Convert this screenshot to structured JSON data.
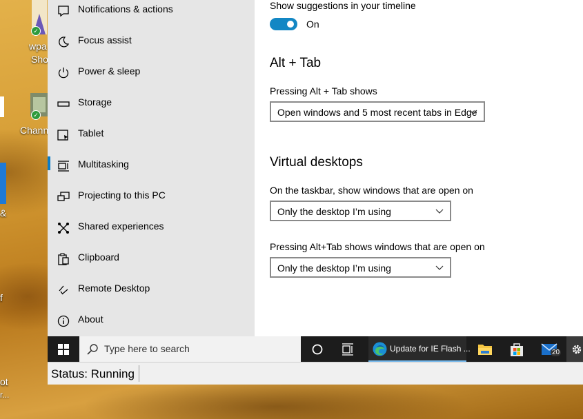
{
  "desktop": {
    "icons": [
      {
        "label": "wpa"
      },
      {
        "label": "Sho"
      },
      {
        "label": "Chann"
      },
      {
        "label": "&"
      },
      {
        "label": "f"
      },
      {
        "label": "ot"
      },
      {
        "label": "r..."
      }
    ]
  },
  "sidebar": {
    "items": [
      {
        "label": "Notifications & actions",
        "icon": "notification-icon"
      },
      {
        "label": "Focus assist",
        "icon": "moon-icon"
      },
      {
        "label": "Power & sleep",
        "icon": "power-icon"
      },
      {
        "label": "Storage",
        "icon": "storage-icon"
      },
      {
        "label": "Tablet",
        "icon": "tablet-icon"
      },
      {
        "label": "Multitasking",
        "icon": "multitasking-icon",
        "active": true
      },
      {
        "label": "Projecting to this PC",
        "icon": "projecting-icon"
      },
      {
        "label": "Shared experiences",
        "icon": "shared-icon"
      },
      {
        "label": "Clipboard",
        "icon": "clipboard-icon"
      },
      {
        "label": "Remote Desktop",
        "icon": "remote-desktop-icon"
      },
      {
        "label": "About",
        "icon": "info-icon"
      }
    ]
  },
  "main": {
    "timeline_label": "Show suggestions in your timeline",
    "timeline_toggle_state": "On",
    "alt_tab_heading": "Alt + Tab",
    "alt_tab_label": "Pressing Alt + Tab shows",
    "alt_tab_value": "Open windows and 5 most recent tabs in Edge",
    "virtual_desktops_heading": "Virtual desktops",
    "taskbar_label": "On the taskbar, show windows that are open on",
    "taskbar_value": "Only the desktop I’m using",
    "alttab_desktops_label": "Pressing Alt+Tab shows windows that are open on",
    "alttab_desktops_value": "Only the desktop I’m using"
  },
  "taskbar": {
    "search_placeholder": "Type here to search",
    "edge_task_label": "Update for IE Flash ...",
    "mail_badge": "20"
  },
  "statusbar": {
    "text": "Status: Running"
  },
  "colors": {
    "accent": "#0a7cc7",
    "toggle": "#1387c4",
    "taskbar": "#1c1c1c",
    "sidebar": "#e6e6e6"
  }
}
